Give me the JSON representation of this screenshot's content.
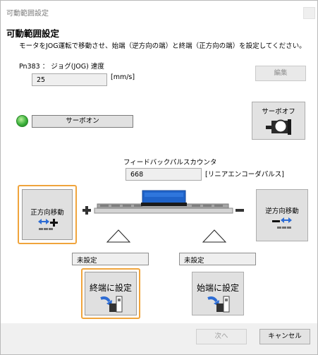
{
  "window": {
    "title": "可動範囲設定"
  },
  "header": {
    "title": "可動範囲設定",
    "instruction": "モータをJOG運転で移動させ、始端（逆方向の端）と終端（正方向の端）を設定してください。"
  },
  "jog_speed": {
    "label": "Pn383 ： ジョグ(JOG) 速度",
    "value": "25",
    "unit": "[mm/s]",
    "edit_label": "編集"
  },
  "servo": {
    "on_label": "サーボオン",
    "off_label": "サーボオフ",
    "led_color": "#3cb13c"
  },
  "feedback": {
    "label": "フィードバックパルスカウンタ",
    "value": "668",
    "unit": "[リニアエンコーダパルス]"
  },
  "forward_button": {
    "label": "正方向移動"
  },
  "reverse_button": {
    "label": "逆方向移動"
  },
  "left_status": {
    "value": "未設定"
  },
  "right_status": {
    "value": "未設定"
  },
  "set_end_button": {
    "label": "終端に設定"
  },
  "set_start_button": {
    "label": "始端に設定"
  },
  "footer": {
    "next_label": "次へ",
    "cancel_label": "キャンセル"
  },
  "colors": {
    "highlight": "#f0a43c",
    "slider": "#1f63c9",
    "arrow": "#2d6cd4"
  }
}
